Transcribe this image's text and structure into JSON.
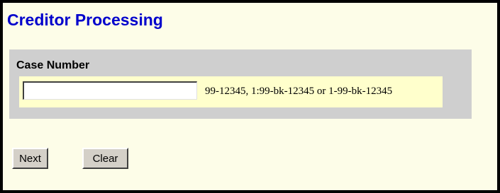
{
  "page": {
    "title": "Creditor Processing"
  },
  "case_section": {
    "label": "Case Number",
    "input_value": "",
    "input_placeholder": "",
    "format_hint": "99-12345, 1:99-bk-12345 or 1-99-bk-12345"
  },
  "actions": {
    "next_label": "Next",
    "clear_label": "Clear"
  },
  "colors": {
    "title": "#0000cc",
    "background": "#fdfde8",
    "panel": "#cfcfcf",
    "input_band": "#ffffcc",
    "button": "#d4d0c8"
  }
}
